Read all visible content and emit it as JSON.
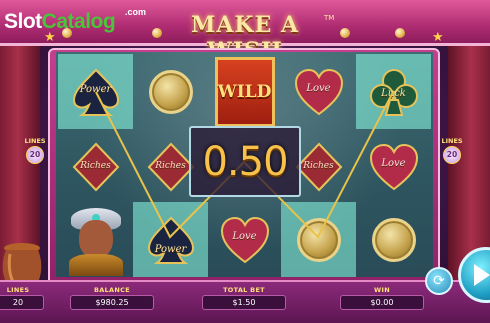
{
  "watermark": {
    "slot": "Slot",
    "catalog": "Catalog",
    "com": ".com"
  },
  "game": {
    "title": "MAKE A WISH",
    "tm": "TM"
  },
  "lines_indicator": {
    "label": "LINES",
    "value": "20"
  },
  "win_amount": "0.50",
  "reels": [
    [
      "power-spade",
      "riches-diamond",
      "genie"
    ],
    [
      "gold-coin",
      "riches-diamond",
      "power-spade"
    ],
    [
      "wild",
      "wild",
      "love-heart"
    ],
    [
      "love-heart",
      "riches-diamond",
      "gold-coin"
    ],
    [
      "luck-club",
      "love-heart",
      "gold-coin"
    ]
  ],
  "symbol_labels": {
    "power": "Power",
    "riches": "Riches",
    "wild": "WILD",
    "love": "Love",
    "luck": "Luck"
  },
  "bottom_bar": {
    "lines": {
      "label": "LINES",
      "value": "20"
    },
    "balance": {
      "label": "BALANCE",
      "value": "$980.25"
    },
    "total_bet": {
      "label": "TOTAL BET",
      "value": "$1.50"
    },
    "win": {
      "label": "WIN",
      "value": "$0.00"
    }
  },
  "controls": {
    "spin_icon": "play-icon",
    "autoplay_icon": "autoplay-icon"
  },
  "colors": {
    "win_text": "#f8c24a",
    "highlight": "#8cffe6",
    "payline": "#e8c24a",
    "frame": "#c53f8e"
  }
}
